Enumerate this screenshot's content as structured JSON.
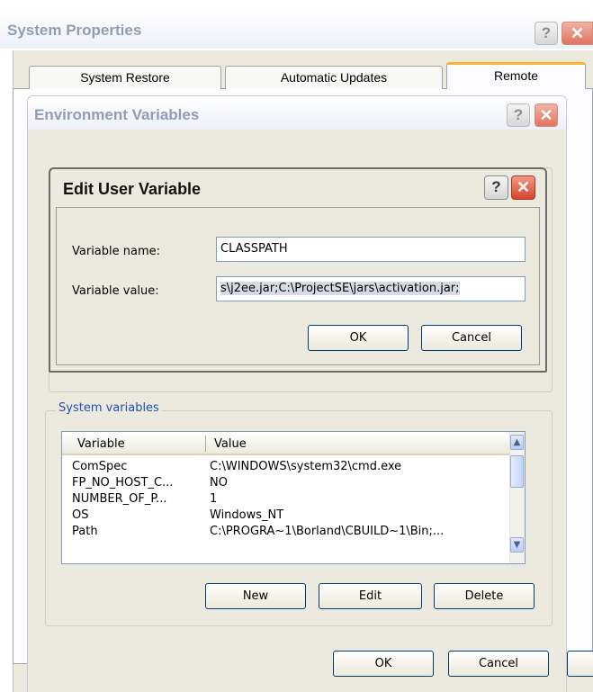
{
  "system_properties": {
    "title": "System Properties",
    "tabs": [
      "System Restore",
      "Automatic Updates",
      "Remote"
    ],
    "ok_label": "OK",
    "cancel_label": "Cancel"
  },
  "env_vars": {
    "title": "Environment Variables",
    "system_group_label": "System variables",
    "columns": [
      "Variable",
      "Value"
    ],
    "rows": [
      {
        "name": "ComSpec",
        "value": "C:\\WINDOWS\\system32\\cmd.exe"
      },
      {
        "name": "FP_NO_HOST_C...",
        "value": "NO"
      },
      {
        "name": "NUMBER_OF_P...",
        "value": "1"
      },
      {
        "name": "OS",
        "value": "Windows_NT"
      },
      {
        "name": "Path",
        "value": "C:\\PROGRA~1\\Borland\\CBUILD~1\\Bin;..."
      }
    ],
    "new_label": "New",
    "edit_label": "Edit",
    "delete_label": "Delete",
    "ok_label": "OK",
    "cancel_label": "Cancel"
  },
  "edit_dialog": {
    "title": "Edit User Variable",
    "name_label": "Variable name:",
    "name_value": "CLASSPATH",
    "value_label": "Variable value:",
    "value_value": "s\\j2ee.jar;C:\\ProjectSE\\jars\\activation.jar;",
    "ok_label": "OK",
    "cancel_label": "Cancel"
  },
  "icons": {
    "help": "?",
    "close": "✕",
    "scroll_up": "▲",
    "scroll_down": "▼"
  }
}
